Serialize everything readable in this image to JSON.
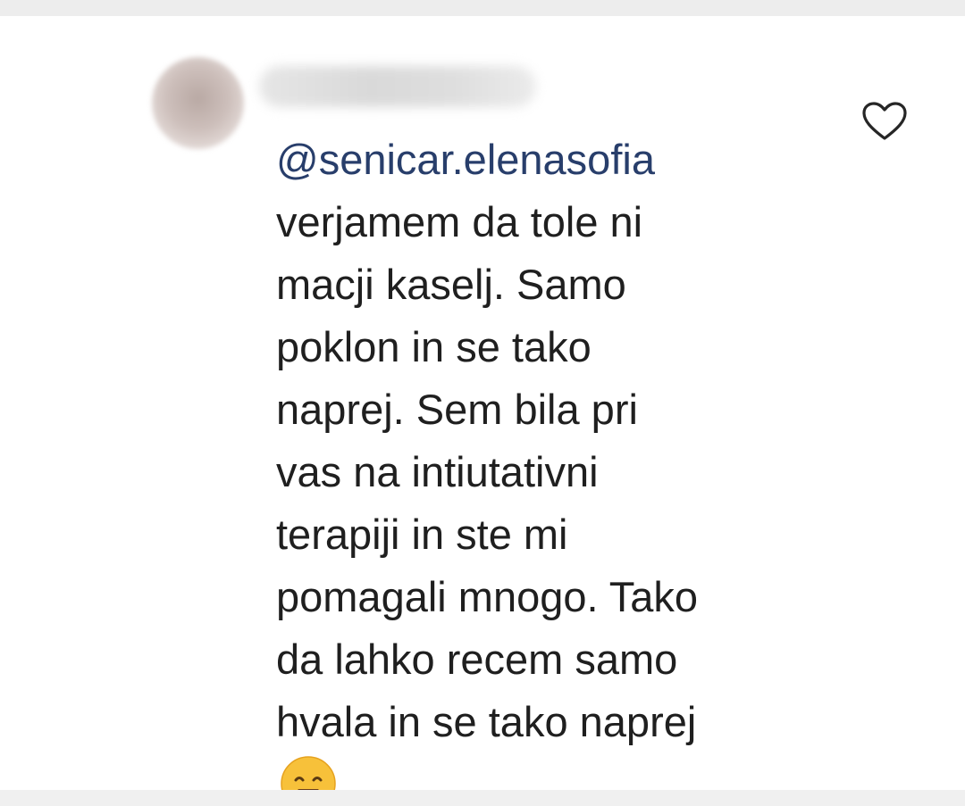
{
  "comment": {
    "author_redacted": true,
    "mention": "@senicar.elenasofia",
    "lines": [
      "verjamem da tole ni",
      "macji kaselj. Samo",
      "poklon in se tako",
      "naprej. Sem bila pri",
      "vas na intiutativni",
      "terapiji in ste mi",
      "pomagali mnogo. Tako",
      "da lahko recem samo",
      "hvala in se tako naprej"
    ],
    "emoji": "hugging-face-emoji",
    "like_icon": "heart-outline-icon"
  },
  "colors": {
    "mention": "#283e6b",
    "text": "#1f1f1f",
    "divider": "#ededed",
    "emoji": "#f5b82e"
  }
}
